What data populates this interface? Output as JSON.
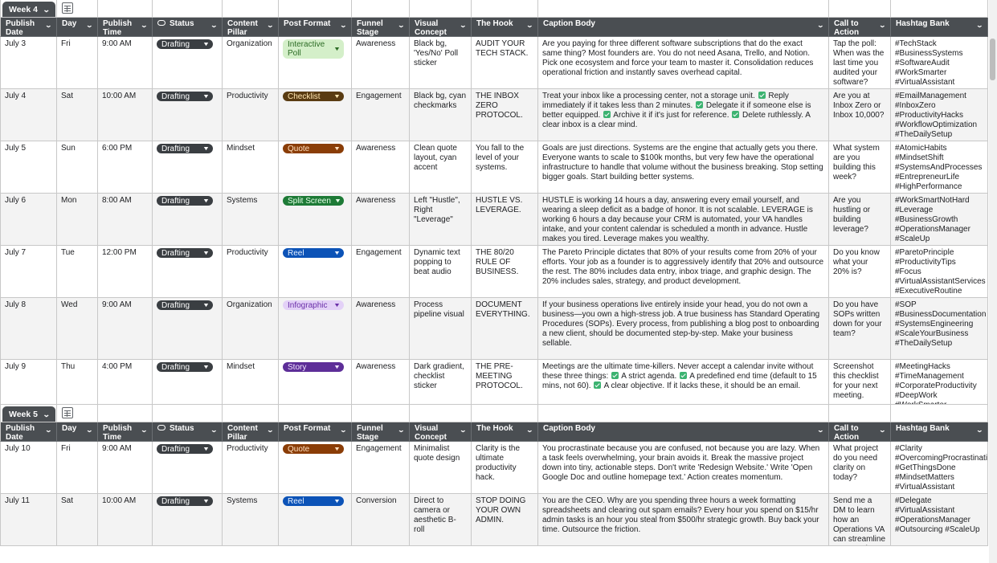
{
  "headers": [
    {
      "label": "Publish Date",
      "icon": "none"
    },
    {
      "label": "Day",
      "icon": "none"
    },
    {
      "label": "Publish Time",
      "icon": "none"
    },
    {
      "label": "Status",
      "icon": "status-icon"
    },
    {
      "label": "Content Pillar",
      "icon": "none"
    },
    {
      "label": "Post Format",
      "icon": "none"
    },
    {
      "label": "Funnel Stage",
      "icon": "none"
    },
    {
      "label": "Visual Concept",
      "icon": "none"
    },
    {
      "label": "The Hook",
      "icon": "none"
    },
    {
      "label": "Caption Body",
      "icon": "none"
    },
    {
      "label": "Call to Action",
      "icon": "none"
    },
    {
      "label": "Hashtag Bank",
      "icon": "none"
    }
  ],
  "groups": [
    {
      "label": "Week 4",
      "rows": [
        {
          "date": "July 3",
          "day": "Fri",
          "time": "9:00 AM",
          "status": "Drafting",
          "pillar": "Organization",
          "format": "Interactive Poll",
          "format_style": "poll",
          "funnel": "Awareness",
          "visual": "Black bg, 'Yes/No' Poll sticker",
          "hook": "AUDIT YOUR TECH STACK.",
          "caption": "Are you paying for three different software subscriptions that do the exact same thing? Most founders are. You do not need Asana, Trello, and Notion. Pick one ecosystem and force your team to master it. Consolidation reduces operational friction and instantly saves overhead capital.",
          "cta": "Tap the poll: When was the last time you audited your software?",
          "hashtags": "#TechStack #BusinessSystems #SoftwareAudit #WorkSmarter #VirtualAssistant"
        },
        {
          "date": "July 4",
          "day": "Sat",
          "time": "10:00 AM",
          "status": "Drafting",
          "pillar": "Productivity",
          "format": "Checklist",
          "format_style": "checklist",
          "funnel": "Engagement",
          "visual": "Black bg, cyan checkmarks",
          "hook": "THE INBOX ZERO PROTOCOL.",
          "caption_parts": [
            "Treat your inbox like a processing center, not a storage unit.",
            "Reply immediately if it takes less than 2 minutes.",
            "Delegate it if someone else is better equipped.",
            "Archive it if it's just for reference.",
            "Delete ruthlessly. A clear inbox is a clear mind."
          ],
          "cta": "Are you at Inbox Zero or Inbox 10,000?",
          "hashtags": "#EmailManagement #InboxZero #ProductivityHacks #WorkflowOptimization #TheDailySetup"
        },
        {
          "date": "July 5",
          "day": "Sun",
          "time": "6:00 PM",
          "status": "Drafting",
          "pillar": "Mindset",
          "format": "Quote",
          "format_style": "quote",
          "funnel": "Awareness",
          "visual": "Clean quote layout, cyan accent",
          "hook": "You fall to the level of your systems.",
          "caption": "Goals are just directions. Systems are the engine that actually gets you there. Everyone wants to scale to $100k months, but very few have the operational infrastructure to handle that volume without the business breaking. Stop setting bigger goals. Start building better systems.",
          "cta": "What system are you building this week?",
          "hashtags": "#AtomicHabits #MindsetShift #SystemsAndProcesses #EntrepreneurLife #HighPerformance"
        },
        {
          "date": "July 6",
          "day": "Mon",
          "time": "8:00 AM",
          "status": "Drafting",
          "pillar": "Systems",
          "format": "Split Screen",
          "format_style": "split",
          "funnel": "Awareness",
          "visual": "Left \"Hustle\", Right \"Leverage\"",
          "hook": "HUSTLE VS. LEVERAGE.",
          "caption": "HUSTLE is working 14 hours a day, answering every email yourself, and wearing a sleep deficit as a badge of honor. It is not scalable. LEVERAGE is working 6 hours a day because your CRM is automated, your VA handles intake, and your content calendar is scheduled a month in advance. Hustle makes you tired. Leverage makes you wealthy.",
          "cta": "Are you hustling or building leverage?",
          "hashtags": "#WorkSmartNotHard #Leverage #BusinessGrowth #OperationsManager #ScaleUp"
        },
        {
          "date": "July 7",
          "day": "Tue",
          "time": "12:00 PM",
          "status": "Drafting",
          "pillar": "Productivity",
          "format": "Reel",
          "format_style": "reel",
          "funnel": "Engagement",
          "visual": "Dynamic text popping to beat audio",
          "hook": "THE 80/20 RULE OF BUSINESS.",
          "caption": "The Pareto Principle dictates that 80% of your results come from 20% of your efforts. Your job as a founder is to aggressively identify that 20% and outsource the rest. The 80% includes data entry, inbox triage, and graphic design. The 20% includes sales, strategy, and product development.",
          "cta": "Do you know what your 20% is?",
          "hashtags": "#ParetoPrinciple #ProductivityTips #Focus #VirtualAssistantServices #ExecutiveRoutine"
        },
        {
          "date": "July 8",
          "day": "Wed",
          "time": "9:00 AM",
          "status": "Drafting",
          "pillar": "Organization",
          "format": "Infographic",
          "format_style": "info",
          "funnel": "Awareness",
          "visual": "Process pipeline visual",
          "hook": "DOCUMENT EVERYTHING.",
          "caption": "If your business operations live entirely inside your head, you do not own a business—you own a high-stress job. A true business has Standard Operating Procedures (SOPs). Every process, from publishing a blog post to onboarding a new client, should be documented step-by-step. Make your business sellable.",
          "cta": "Do you have SOPs written down for your team?",
          "hashtags": "#SOP #BusinessDocumentation #SystemsEngineering #ScaleYourBusiness #TheDailySetup"
        },
        {
          "date": "July 9",
          "day": "Thu",
          "time": "4:00 PM",
          "status": "Drafting",
          "pillar": "Mindset",
          "format": "Story",
          "format_style": "story",
          "funnel": "Awareness",
          "visual": "Dark gradient, checklist sticker",
          "hook": "THE PRE-MEETING PROTOCOL.",
          "caption_parts": [
            "Meetings are the ultimate time-killers. Never accept a calendar invite without these three things:",
            "A strict agenda.",
            "A predefined end time (default to 15 mins, not 60).",
            "A clear objective. If it lacks these, it should be an email."
          ],
          "cta": "Screenshot this checklist for your next meeting.",
          "hashtags": "#MeetingHacks #TimeManagement #CorporateProductivity #DeepWork #WorkSmarter"
        }
      ]
    },
    {
      "label": "Week 5",
      "rows": [
        {
          "date": "July 10",
          "day": "Fri",
          "time": "9:00 AM",
          "status": "Drafting",
          "pillar": "Productivity",
          "format": "Quote",
          "format_style": "quote",
          "funnel": "Engagement",
          "visual": "Minimalist quote design",
          "hook": "Clarity is the ultimate productivity hack.",
          "caption": "You procrastinate because you are confused, not because you are lazy. When a task feels overwhelming, your brain avoids it. Break the massive project down into tiny, actionable steps. Don't write 'Redesign Website.' Write 'Open Google Doc and outline homepage text.' Action creates momentum.",
          "cta": "What project do you need clarity on today?",
          "hashtags": "#Clarity #OvercomingProcrastination #GetThingsDone #MindsetMatters #VirtualAssistant"
        },
        {
          "date": "July 11",
          "day": "Sat",
          "time": "10:00 AM",
          "status": "Drafting",
          "pillar": "Systems",
          "format": "Reel",
          "format_style": "reel",
          "funnel": "Conversion",
          "visual": "Direct to camera or aesthetic B-roll",
          "hook": "STOP DOING YOUR OWN ADMIN.",
          "caption": "You are the CEO. Why are you spending three hours a week formatting spreadsheets and clearing out spam emails? Every hour you spend on $15/hr admin tasks is an hour you steal from $500/hr strategic growth. Buy back your time. Outsource the friction.",
          "cta": "Send me a DM to learn how an Operations VA can streamline your week.",
          "hashtags": "#Delegate #VirtualAssistant #OperationsManager #Outsourcing #ScaleUp"
        }
      ]
    }
  ]
}
